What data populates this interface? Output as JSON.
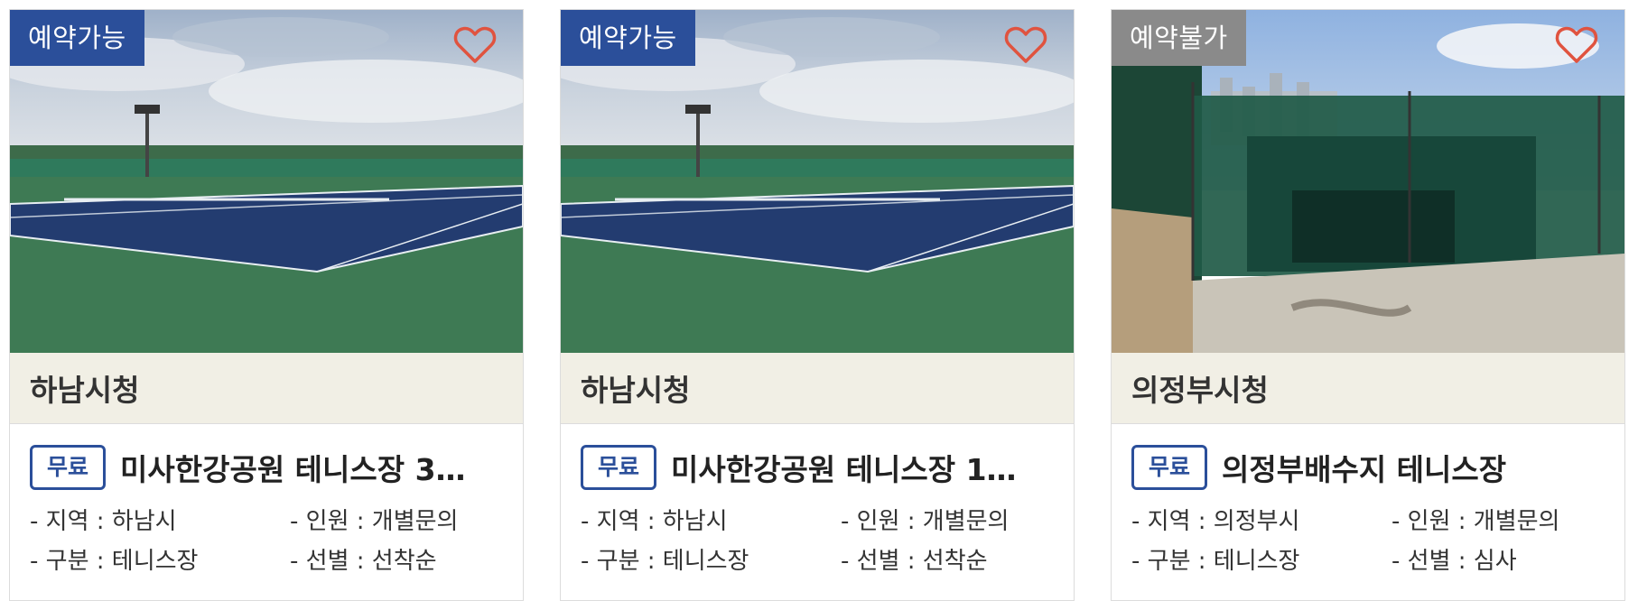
{
  "cards": [
    {
      "status": "예약가능",
      "org": "하남시청",
      "fee": "무료",
      "title": "미사한강공원 테니스장 3…",
      "region": "- 지역 : 하남시",
      "people": "- 인원 : 개별문의",
      "category": "- 구분 : 테니스장",
      "selection": "- 선별 : 선착순"
    },
    {
      "status": "예약가능",
      "org": "하남시청",
      "fee": "무료",
      "title": "미사한강공원 테니스장 1…",
      "region": "- 지역 : 하남시",
      "people": "- 인원 : 개별문의",
      "category": "- 구분 : 테니스장",
      "selection": "- 선별 : 선착순"
    },
    {
      "status": "예약불가",
      "org": "의정부시청",
      "fee": "무료",
      "title": "의정부배수지 테니스장",
      "region": "- 지역 : 의정부시",
      "people": "- 인원 : 개별문의",
      "category": "- 구분 : 테니스장",
      "selection": "- 선별 : 심사"
    }
  ],
  "colors": {
    "available": "#2b4f9a",
    "unavailable": "#8a8a8a",
    "heart": "#e0533f",
    "org_bg": "#f1efe5"
  },
  "icons": {
    "favorite": "heart-outline-icon"
  }
}
